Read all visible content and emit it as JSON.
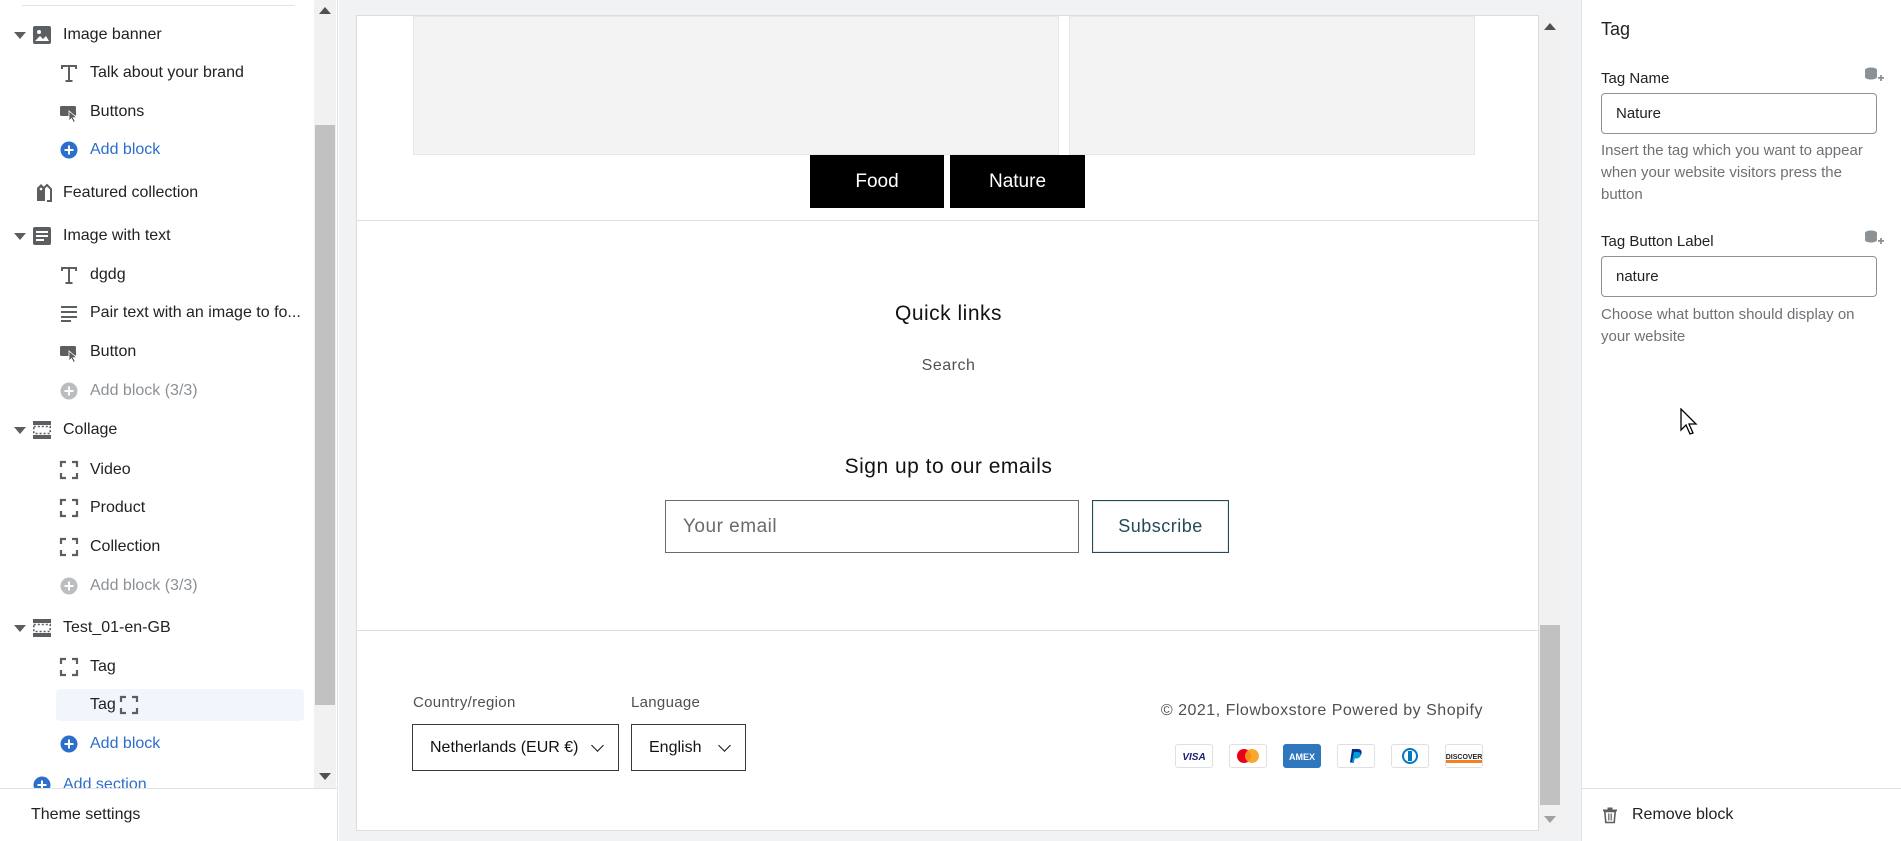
{
  "sidebar": {
    "items": [
      {
        "label": "Image banner",
        "level": 0,
        "icon": "image-icon",
        "caret": true
      },
      {
        "label": "Talk about your brand",
        "level": 1,
        "icon": "text-icon"
      },
      {
        "label": "Buttons",
        "level": 1,
        "icon": "button-icon"
      },
      {
        "label": "Add block",
        "level": 1,
        "icon": "add-circle-icon",
        "style": "blue"
      },
      {
        "label": "Featured collection",
        "level": 0,
        "icon": "collection-tag-icon"
      },
      {
        "label": "Image with text",
        "level": 0,
        "icon": "image-with-text-icon",
        "caret": true
      },
      {
        "label": "dgdg",
        "level": 1,
        "icon": "text-icon"
      },
      {
        "label": "Pair text with an image to fo...",
        "level": 1,
        "icon": "paragraph-icon"
      },
      {
        "label": "Button",
        "level": 1,
        "icon": "button-icon"
      },
      {
        "label": "Add block (3/3)",
        "level": 1,
        "icon": "add-circle-icon",
        "style": "grey"
      },
      {
        "label": "Collage",
        "level": 0,
        "icon": "section-icon",
        "caret": true
      },
      {
        "label": "Video",
        "level": 1,
        "icon": "block-icon"
      },
      {
        "label": "Product",
        "level": 1,
        "icon": "block-icon"
      },
      {
        "label": "Collection",
        "level": 1,
        "icon": "block-icon"
      },
      {
        "label": "Add block (3/3)",
        "level": 1,
        "icon": "add-circle-icon",
        "style": "grey"
      },
      {
        "label": "Test_01-en-GB",
        "level": 0,
        "icon": "section-icon",
        "caret": true
      },
      {
        "label": "Tag",
        "level": 1,
        "icon": "block-icon"
      },
      {
        "label": "Tag",
        "level": 1,
        "icon": "block-icon",
        "selected": true
      },
      {
        "label": "Add block",
        "level": 1,
        "icon": "add-circle-icon",
        "style": "blue"
      },
      {
        "label": "Add section",
        "level": 0,
        "icon": "add-circle-icon",
        "style": "blue"
      }
    ],
    "theme_settings": "Theme settings"
  },
  "preview": {
    "tags": [
      "Food",
      "Nature"
    ],
    "quick_links_title": "Quick links",
    "quick_link_search": "Search",
    "signup_title": "Sign up to our emails",
    "email_placeholder": "Your email",
    "subscribe_label": "Subscribe",
    "country_label": "Country/region",
    "country_value": "Netherlands (EUR €)",
    "language_label": "Language",
    "language_value": "English",
    "copyright": "© 2021, Flowboxstore Powered by Shopify",
    "payments": [
      "Visa",
      "Mastercard",
      "American Express",
      "PayPal",
      "Diners Club",
      "Discover"
    ]
  },
  "inspector": {
    "title": "Tag",
    "tag_name_label": "Tag Name",
    "tag_name_value": "Nature",
    "tag_name_help": "Insert the tag which you want to appear when your website visitors press the button",
    "tag_button_label": "Tag Button Label",
    "tag_button_value": "nature",
    "tag_button_help": "Choose what button should display on your website",
    "remove_block": "Remove block"
  },
  "colors": {
    "accent_blue": "#2c6ecb",
    "selected_bg": "#f1f6fc",
    "tag_button_bg": "#000000",
    "subscribe_border": "#244a5a"
  }
}
